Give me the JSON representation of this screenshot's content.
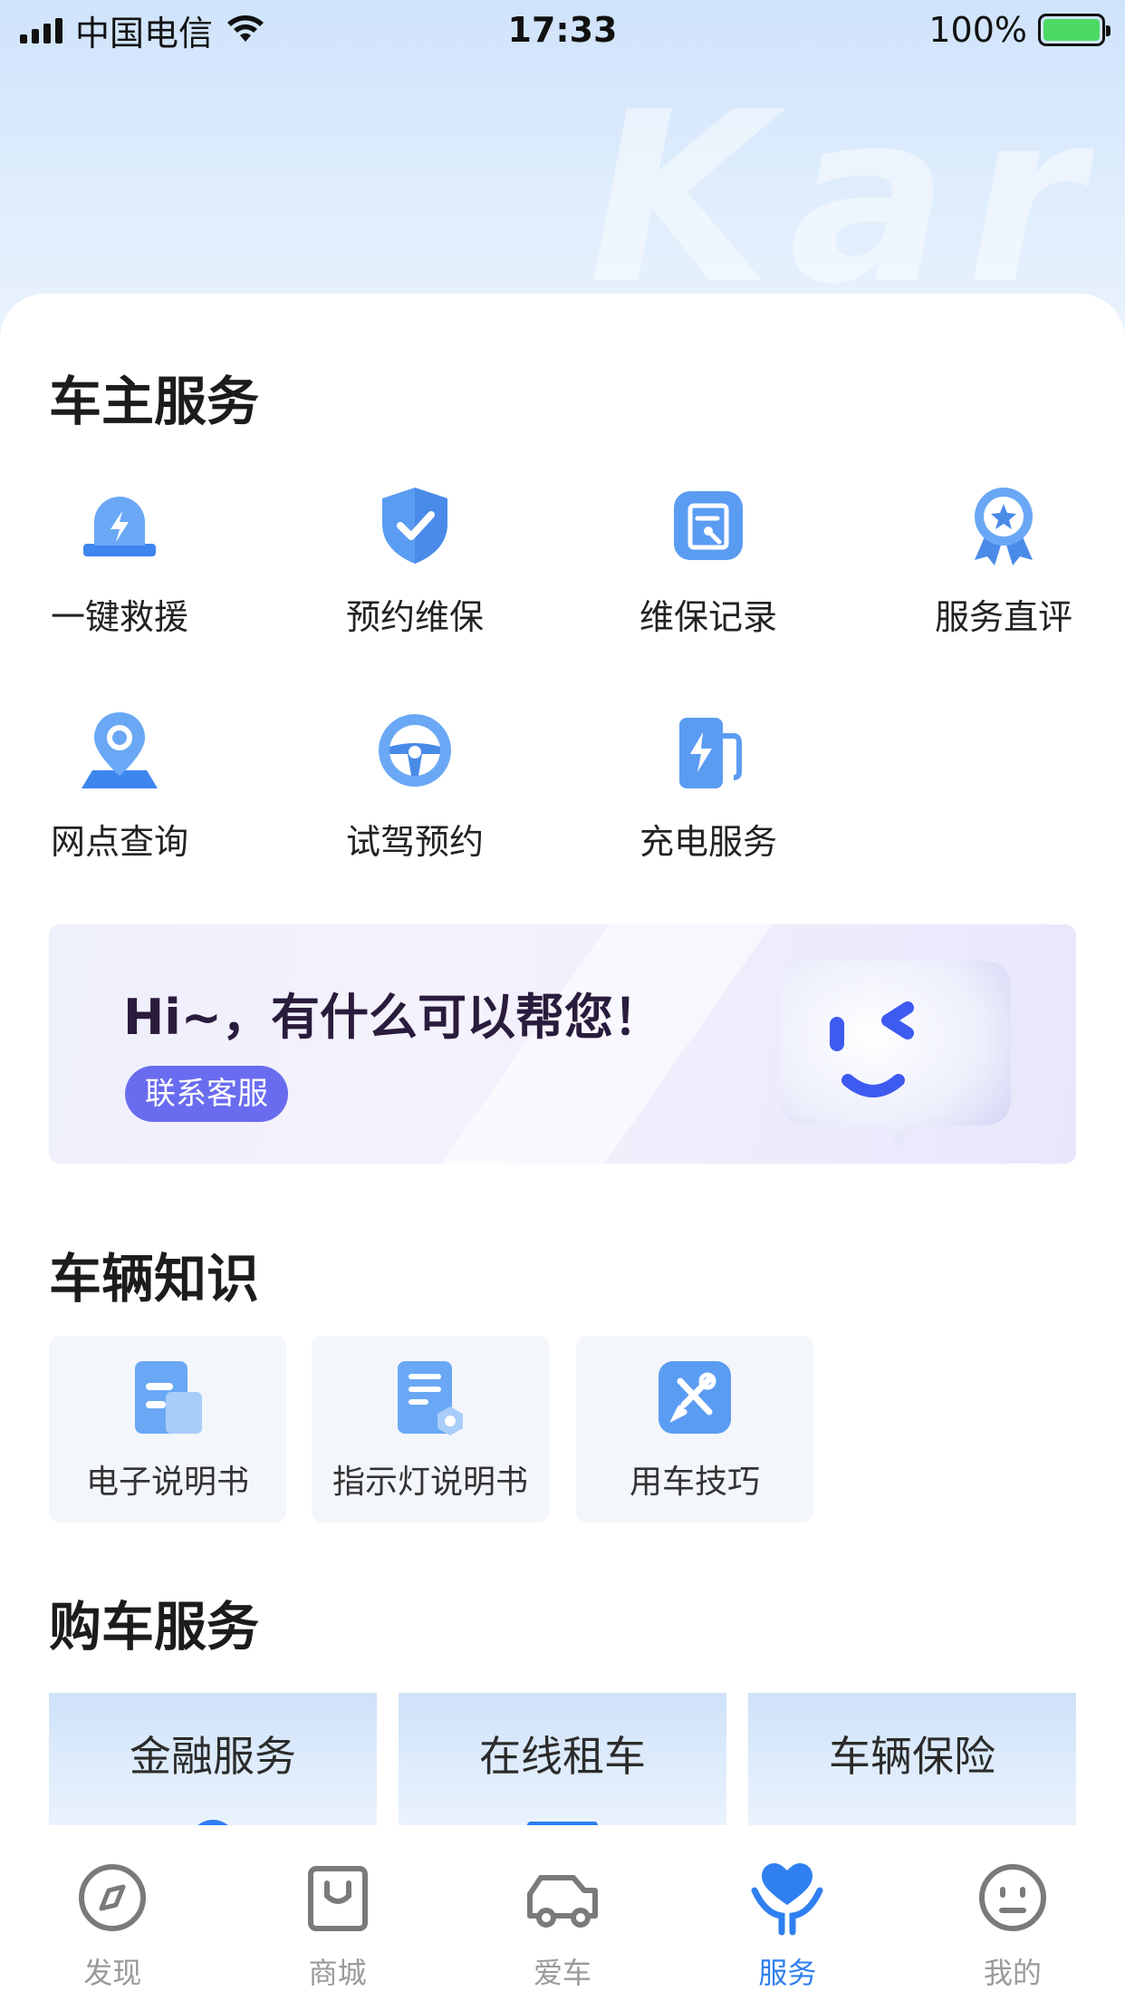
{
  "status_bar": {
    "carrier": "中国电信",
    "time": "17:33",
    "battery": "100%"
  },
  "hero": {
    "watermark": "Kar"
  },
  "owner_services": {
    "title": "车主服务",
    "items": [
      {
        "label": "一键救援",
        "icon": "rescue-icon"
      },
      {
        "label": "预约维保",
        "icon": "shield-check-icon"
      },
      {
        "label": "维保记录",
        "icon": "maintenance-record-icon"
      },
      {
        "label": "服务直评",
        "icon": "rating-badge-icon"
      },
      {
        "label": "网点查询",
        "icon": "location-pin-icon"
      },
      {
        "label": "试驾预约",
        "icon": "steering-wheel-icon"
      },
      {
        "label": "充电服务",
        "icon": "charging-station-icon"
      }
    ]
  },
  "support_banner": {
    "greeting": "Hi~，有什么可以帮您！",
    "button": "联系客服"
  },
  "vehicle_knowledge": {
    "title": "车辆知识",
    "items": [
      {
        "label": "电子说明书",
        "icon": "manual-icon"
      },
      {
        "label": "指示灯说明书",
        "icon": "indicator-manual-icon"
      },
      {
        "label": "用车技巧",
        "icon": "tools-icon"
      }
    ]
  },
  "purchase_services": {
    "title": "购车服务",
    "items": [
      {
        "label": "金融服务"
      },
      {
        "label": "在线租车"
      },
      {
        "label": "车辆保险"
      }
    ]
  },
  "tab_bar": {
    "active": "服务",
    "tabs": [
      {
        "label": "发现",
        "icon": "compass-icon"
      },
      {
        "label": "商城",
        "icon": "shopping-bag-icon"
      },
      {
        "label": "爱车",
        "icon": "car-icon"
      },
      {
        "label": "服务",
        "icon": "heart-hand-icon"
      },
      {
        "label": "我的",
        "icon": "face-icon"
      }
    ]
  },
  "colors": {
    "accent": "#2f7ff0",
    "icon_blue": "#4a90ef",
    "button_purple": "#6a6cf0",
    "tab_inactive": "#9a9a9a"
  }
}
